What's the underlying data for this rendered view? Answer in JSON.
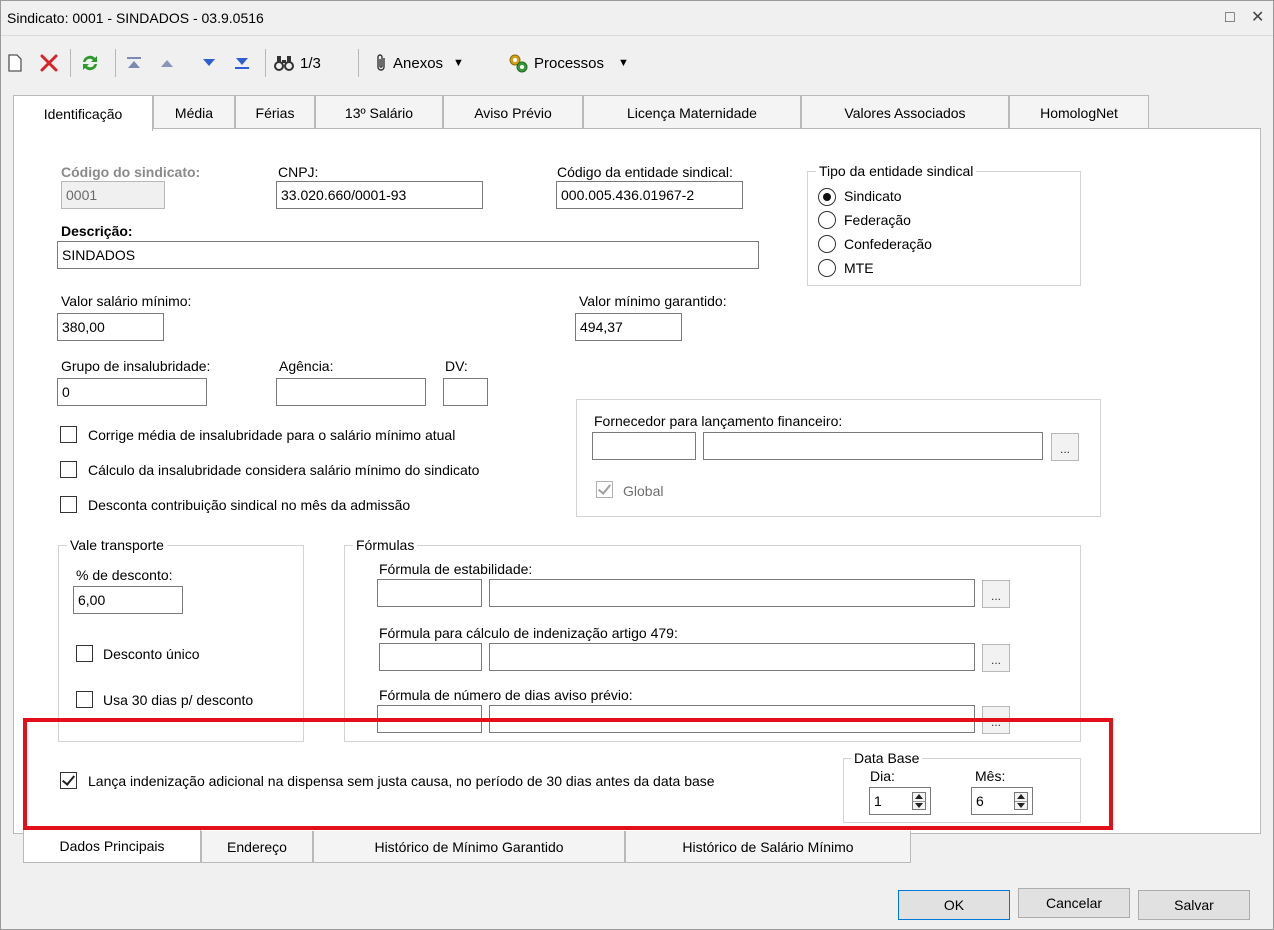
{
  "window": {
    "title": "Sindicato: 0001 - SINDADOS - 03.9.0516",
    "controls": {
      "restore": "□",
      "close": "✕"
    }
  },
  "toolbar": {
    "record_counter": "1/3",
    "anexos_label": "Anexos",
    "processos_label": "Processos",
    "icons": [
      "new-icon",
      "delete-icon",
      "refresh-icon",
      "first-record-icon",
      "previous-record-icon",
      "next-record-icon",
      "last-record-icon",
      "binoculars-icon",
      "paperclip-icon",
      "gears-icon"
    ]
  },
  "top_tabs": [
    {
      "label": "Identificação",
      "active": true
    },
    {
      "label": "Média"
    },
    {
      "label": "Férias"
    },
    {
      "label": "13º Salário"
    },
    {
      "label": "Aviso Prévio"
    },
    {
      "label": "Licença Maternidade"
    },
    {
      "label": "Valores Associados"
    },
    {
      "label": "HomologNet"
    }
  ],
  "form": {
    "codigo_sindicato": {
      "label": "Código do sindicato:",
      "value": "0001"
    },
    "cnpj": {
      "label": "CNPJ:",
      "value": "33.020.660/0001-93"
    },
    "codigo_entidade": {
      "label": "Código da entidade sindical:",
      "value": "000.005.436.01967-2"
    },
    "descricao": {
      "label": "Descrição:",
      "value": "SINDADOS"
    },
    "valor_salario_minimo": {
      "label": "Valor salário mínimo:",
      "value": "380,00"
    },
    "valor_minimo_garantido": {
      "label": "Valor mínimo garantido:",
      "value": "494,37"
    },
    "grupo_insalubridade": {
      "label": "Grupo de insalubridade:",
      "value": "0"
    },
    "agencia": {
      "label": "Agência:",
      "value": ""
    },
    "dv": {
      "label": "DV:",
      "value": ""
    },
    "tipo_entidade": {
      "title": "Tipo da entidade sindical",
      "options": [
        "Sindicato",
        "Federação",
        "Confederação",
        "MTE"
      ],
      "selected": "Sindicato"
    },
    "checkboxes": [
      {
        "label": "Corrige média de insalubridade para o salário mínimo atual",
        "checked": false
      },
      {
        "label": "Cálculo da insalubridade considera salário mínimo do sindicato",
        "checked": false
      },
      {
        "label": "Desconta contribuição sindical no mês da admissão",
        "checked": false
      }
    ],
    "fornecedor": {
      "label": "Fornecedor para lançamento financeiro:",
      "global_label": "Global",
      "global_checked": true,
      "dots": "..."
    },
    "vale_transporte": {
      "title": "Vale transporte",
      "desconto_label": "% de desconto:",
      "desconto_value": "6,00",
      "desconto_unico_label": "Desconto único",
      "usa_30_label": "Usa 30 dias p/ desconto"
    },
    "formulas": {
      "title": "Fórmulas",
      "estabilidade_label": "Fórmula de estabilidade:",
      "indenizacao_label": "Fórmula para cálculo de indenização artigo 479:",
      "aviso_label": "Fórmula de número de dias aviso prévio:",
      "dots": "..."
    },
    "lanca_indenizacao": {
      "label": "Lança indenização adicional na dispensa sem justa causa, no período de 30 dias antes da data base",
      "checked": true
    },
    "data_base": {
      "title": "Data Base",
      "dia_label": "Dia:",
      "dia_value": "1",
      "mes_label": "Mês:",
      "mes_value": "6"
    }
  },
  "bottom_tabs": [
    {
      "label": "Dados Principais",
      "active": true
    },
    {
      "label": "Endereço"
    },
    {
      "label": "Histórico de Mínimo Garantido"
    },
    {
      "label": "Histórico de Salário Mínimo"
    }
  ],
  "dialog_buttons": {
    "ok": "OK",
    "cancel": "Cancelar",
    "save": "Salvar"
  },
  "colors": {
    "highlight": "#e3101a",
    "delete_red": "#d8232a",
    "refresh_green": "#2e9a2e",
    "nav_blue": "#2c5fd6"
  }
}
